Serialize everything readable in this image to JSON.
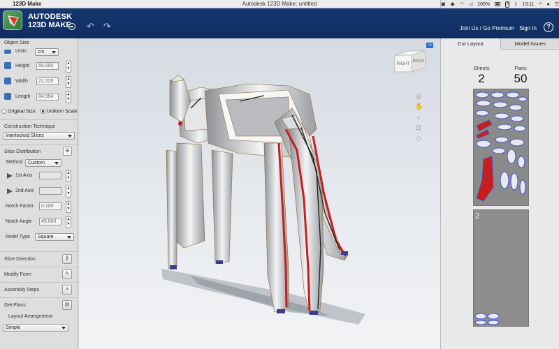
{
  "menubar": {
    "app_name": "123D Make",
    "window_title": "Autodesk 123D Make: untitled",
    "battery": "100%",
    "input_source": "A",
    "clock": "13:11"
  },
  "header": {
    "brand_line1": "AUTODESK",
    "brand_line2": "123D MAKE",
    "join_label": "Join Us / Go Premium",
    "signin_label": "Sign In",
    "help_label": "?"
  },
  "object_size": {
    "title": "Object Size",
    "units_label": "Units",
    "units_value": "cm",
    "height_label": "Height",
    "height_value": "55.000",
    "width_label": "Width",
    "width_value": "21.225",
    "length_label": "Length",
    "length_value": "84.994",
    "original_size_label": "Original Size",
    "uniform_scale_label": "Uniform Scale"
  },
  "construction": {
    "title": "Construction Technique",
    "value": "Interlocked Slices"
  },
  "slice_distribution": {
    "title": "Slice Distribution",
    "method_label": "Method",
    "method_value": "Custom",
    "axis1_label": "1st Axis",
    "axis1_value": "",
    "axis2_label": "2nd Axis",
    "axis2_value": "",
    "notch_factor_label": "Notch Factor",
    "notch_factor_value": "0.100",
    "notch_angle_label": "Notch Angle",
    "notch_angle_value": "45.000",
    "relief_type_label": "Relief Type",
    "relief_type_value": "Square"
  },
  "sections": {
    "slice_direction": "Slice Direction",
    "modify_form": "Modify Form",
    "assembly_steps": "Assembly Steps",
    "get_plans": "Get Plans",
    "layout_arrangement_label": "Layout Arrangement",
    "layout_arrangement_value": "Simple"
  },
  "viewcube": {
    "right_label": "RIGHT",
    "back_label": "BACK"
  },
  "right_panel": {
    "tab_cut_layout": "Cut Layout",
    "tab_model_issues": "Model Issues",
    "sheets_label": "Sheets",
    "sheets_value": "2",
    "parts_label": "Parts",
    "parts_value": "50",
    "sheet2_number": "2"
  },
  "colors": {
    "header_blue": "#12326a",
    "slice_red": "#c81e1e",
    "part_blue": "#3a52d6"
  }
}
